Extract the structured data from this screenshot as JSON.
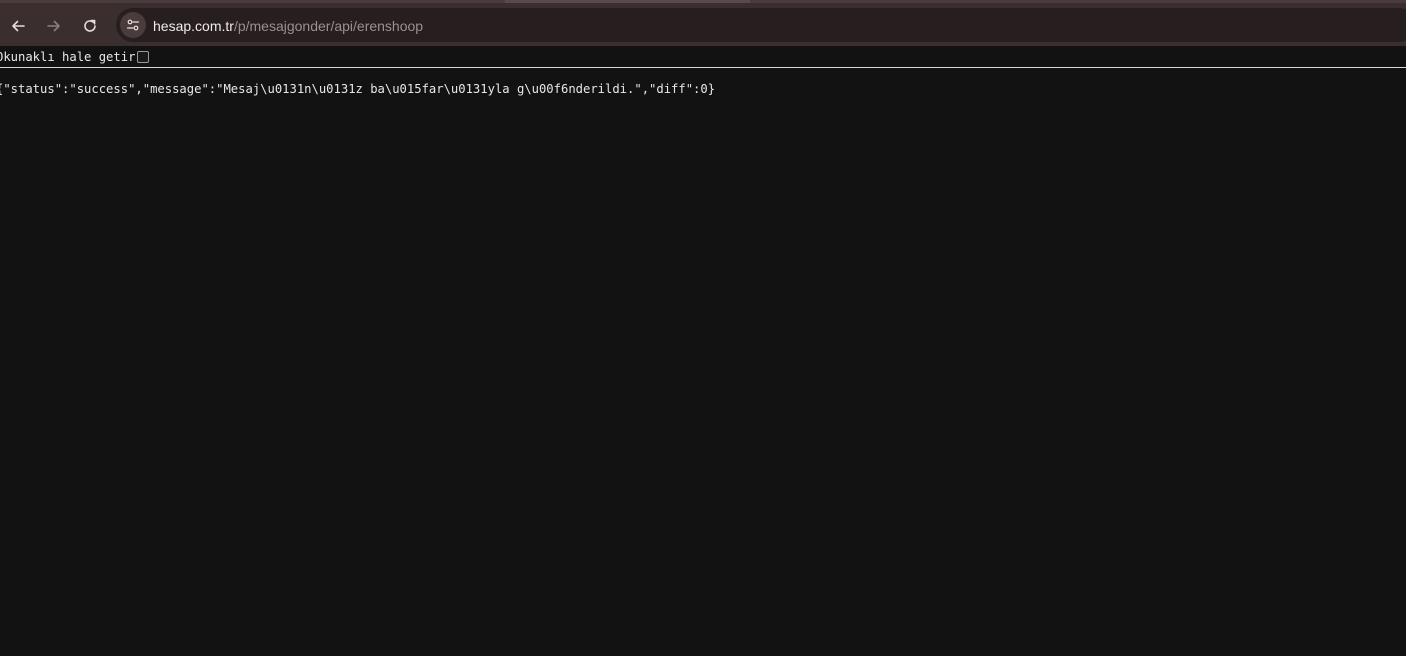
{
  "browser": {
    "url_host": "hesap.com.tr",
    "url_path": "/p/mesajgonder/api/erenshoop",
    "icons": [
      "back-arrow-icon",
      "forward-arrow-icon",
      "reload-icon",
      "site-settings-icon"
    ],
    "colors": {
      "toolbar": "#3a2e2f",
      "omnibox": "#261e1f",
      "page_background": "#121212"
    }
  },
  "json_viewer": {
    "pretty_print_label": "Okunaklı hale getir",
    "pretty_print_checked": false,
    "raw_content": "{\"status\":\"success\",\"message\":\"Mesaj\\u0131n\\u0131z ba\\u015far\\u0131yla g\\u00f6nderildi.\",\"diff\":0}"
  }
}
